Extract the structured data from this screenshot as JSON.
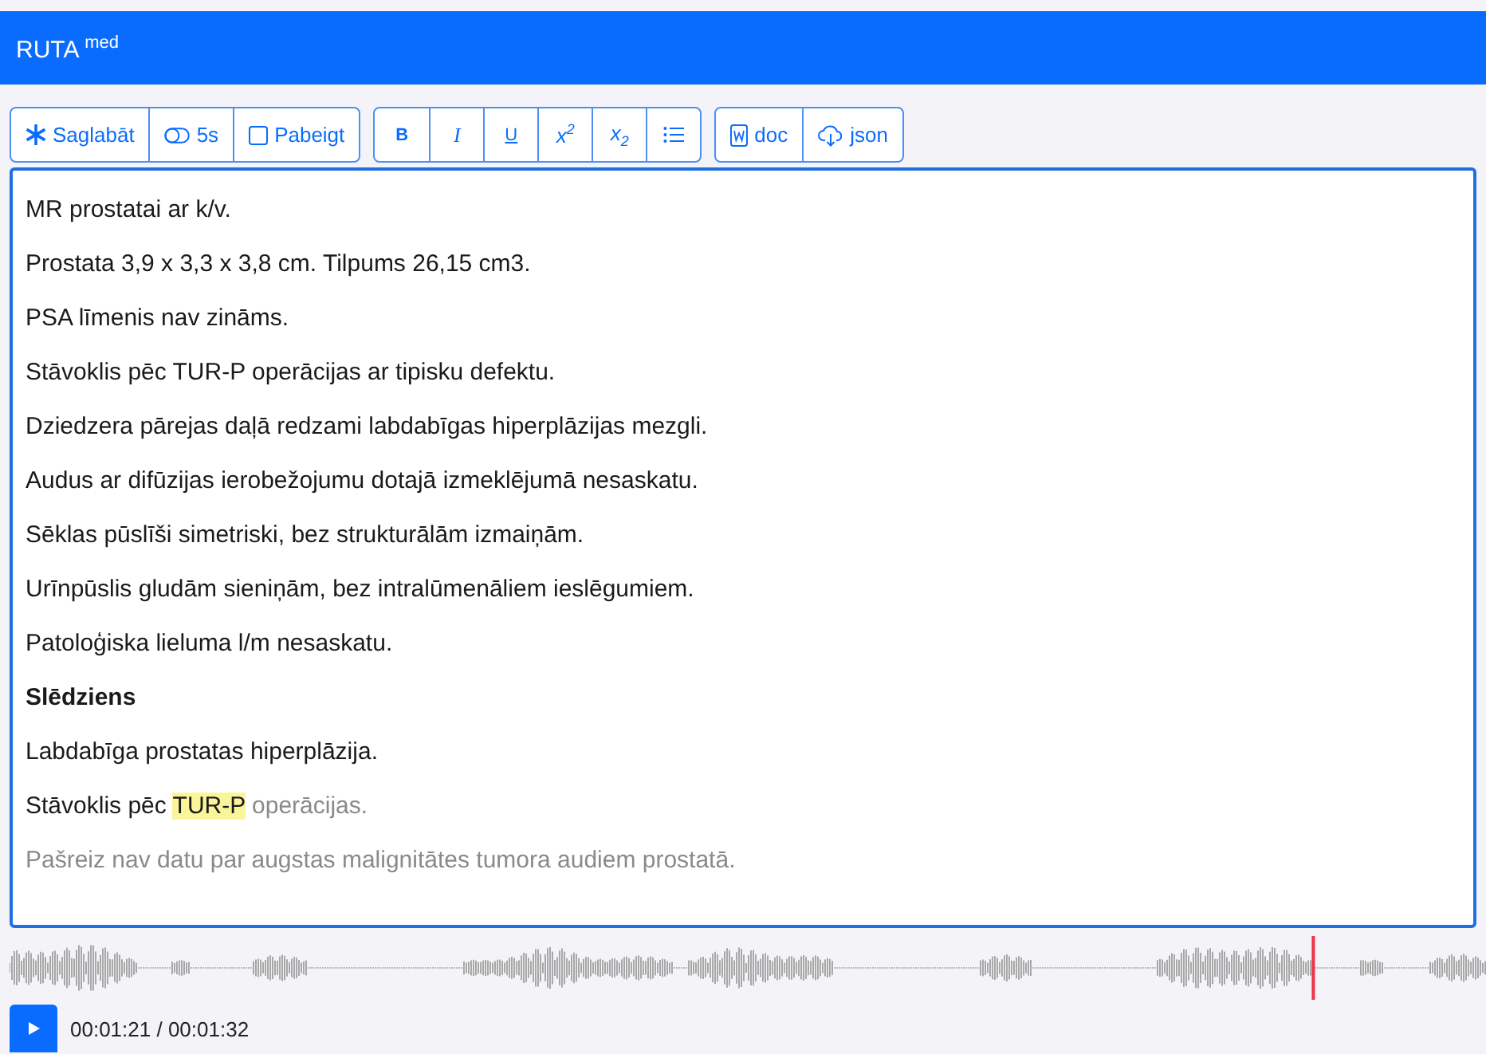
{
  "header": {
    "title": "RUTA $^{med}$"
  },
  "toolbar": {
    "groups": [
      [
        {
          "kind": "save",
          "label": "Saglabāt"
        },
        {
          "kind": "toggle",
          "label": "5s"
        },
        {
          "kind": "checkbox",
          "label": "Pabeigt",
          "checked": false
        }
      ],
      [
        {
          "kind": "bold",
          "label": "B"
        },
        {
          "kind": "italic",
          "label": "I"
        },
        {
          "kind": "underline",
          "label": "U"
        },
        {
          "kind": "rich",
          "label": "x$^{2}$"
        },
        {
          "kind": "rich",
          "label": "x$_{2}$"
        },
        {
          "kind": "list"
        }
      ],
      [
        {
          "kind": "doc",
          "label": "doc"
        },
        {
          "kind": "json",
          "label": "json"
        }
      ]
    ]
  },
  "editor": {
    "paragraphs": [
      {
        "kind": "text",
        "segments": [
          {
            "kind": "normal",
            "text": "MR prostatai ar k/v."
          }
        ]
      },
      {
        "kind": "text",
        "segments": [
          {
            "kind": "normal",
            "text": "Prostata 3,9 x 3,3 x 3,8 cm. Tilpums 26,15 cm3."
          }
        ]
      },
      {
        "kind": "text",
        "segments": [
          {
            "kind": "normal",
            "text": "PSA līmenis nav zināms."
          }
        ]
      },
      {
        "kind": "text",
        "segments": [
          {
            "kind": "normal",
            "text": "Stāvoklis pēc TUR-P operācijas ar tipisku defektu."
          }
        ]
      },
      {
        "kind": "text",
        "segments": [
          {
            "kind": "normal",
            "text": "Dziedzera pārejas daļā redzami labdabīgas hiperplāzijas mezgli."
          }
        ]
      },
      {
        "kind": "text",
        "segments": [
          {
            "kind": "normal",
            "text": "Audus ar difūzijas ierobežojumu dotajā izmeklējumā nesaskatu."
          }
        ]
      },
      {
        "kind": "text",
        "segments": [
          {
            "kind": "normal",
            "text": "Sēklas pūslīši simetriski, bez strukturālām izmaiņām."
          }
        ]
      },
      {
        "kind": "text",
        "segments": [
          {
            "kind": "normal",
            "text": "Urīnpūslis gludām sieniņām, bez intralūmenāliem ieslēgumiem."
          }
        ]
      },
      {
        "kind": "text",
        "segments": [
          {
            "kind": "normal",
            "text": "Patoloģiska lieluma l/m nesaskatu."
          }
        ]
      },
      {
        "kind": "heading",
        "segments": [
          {
            "kind": "normal",
            "text": "Slēdziens"
          }
        ]
      },
      {
        "kind": "text",
        "segments": [
          {
            "kind": "normal",
            "text": "Labdabīga prostatas hiperplāzija."
          }
        ]
      },
      {
        "kind": "text",
        "segments": [
          {
            "kind": "normal",
            "text": "Stāvoklis pēc "
          },
          {
            "kind": "highlight",
            "text": "TUR-P"
          },
          {
            "kind": "pending",
            "text": " operācijas."
          }
        ]
      },
      {
        "kind": "text",
        "segments": [
          {
            "kind": "pending",
            "text": "Pašreiz nav datu par augstas malignitātes tumora audiem prostatā."
          }
        ]
      }
    ]
  },
  "player": {
    "level": 0.882,
    "time": "00:01:21 / 00:01:32"
  }
}
